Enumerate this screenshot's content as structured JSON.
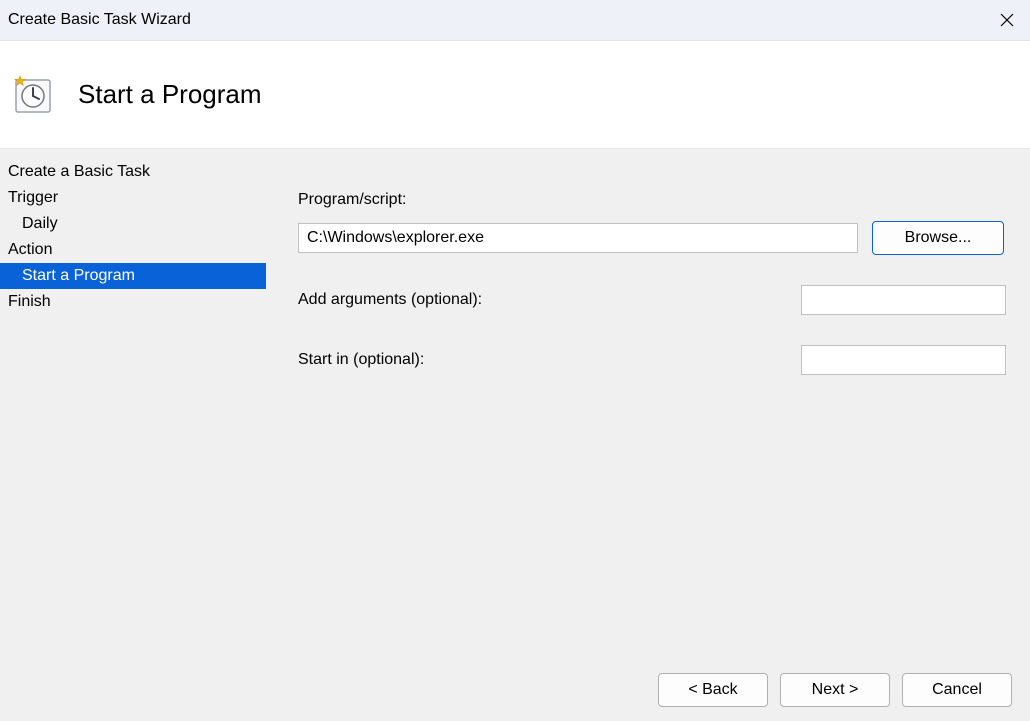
{
  "window": {
    "title": "Create Basic Task Wizard"
  },
  "header": {
    "title": "Start a Program"
  },
  "sidebar": {
    "steps": [
      {
        "label": "Create a Basic Task",
        "indent": false,
        "selected": false
      },
      {
        "label": "Trigger",
        "indent": false,
        "selected": false
      },
      {
        "label": "Daily",
        "indent": true,
        "selected": false
      },
      {
        "label": "Action",
        "indent": false,
        "selected": false
      },
      {
        "label": "Start a Program",
        "indent": true,
        "selected": true
      },
      {
        "label": "Finish",
        "indent": false,
        "selected": false
      }
    ]
  },
  "form": {
    "program_label": "Program/script:",
    "program_value": "C:\\Windows\\explorer.exe",
    "browse_label": "Browse...",
    "args_label": "Add arguments (optional):",
    "args_value": "",
    "startin_label": "Start in (optional):",
    "startin_value": ""
  },
  "footer": {
    "back": "< Back",
    "next": "Next >",
    "cancel": "Cancel"
  }
}
